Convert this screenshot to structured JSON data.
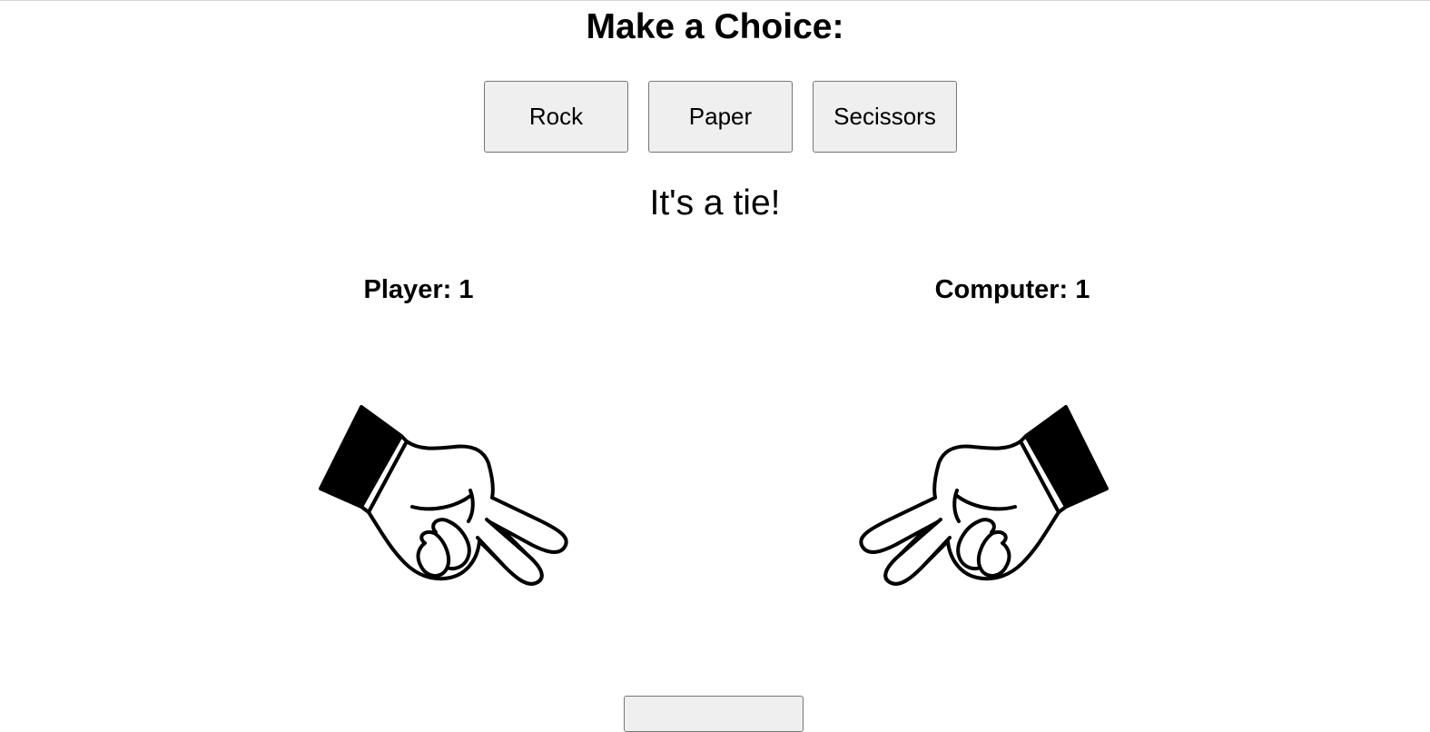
{
  "header": {
    "title": "Make a Choice:"
  },
  "choices": [
    {
      "label": "Rock"
    },
    {
      "label": "Paper"
    },
    {
      "label": "Secissors"
    }
  ],
  "result": {
    "message": "It's a tie!"
  },
  "scores": {
    "player": "Player: 1",
    "computer": "Computer: 1"
  },
  "hands": {
    "player": "scissors-hand-icon",
    "computer": "scissors-hand-icon"
  }
}
